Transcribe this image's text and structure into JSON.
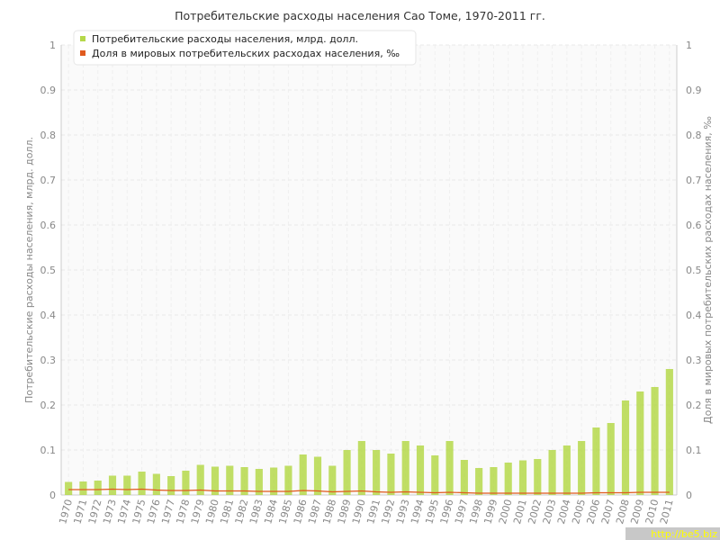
{
  "watermark": "http://be5.biz",
  "chart_data": {
    "type": "bar",
    "title": "Потребительские расходы населения Сао Томе, 1970-2011 гг.",
    "ylabel": "Потребительские расходы населения, млрд. долл.",
    "y2label": "Доля в мировых потребительских расходах населения, ‰",
    "ylim": [
      0,
      1
    ],
    "y2lim": [
      0,
      1
    ],
    "yticks": [
      "0",
      "0.1",
      "0.2",
      "0.3",
      "0.4",
      "0.5",
      "0.6",
      "0.7",
      "0.8",
      "0.9",
      "1"
    ],
    "grid": true,
    "legend_position": "top-left",
    "categories": [
      "1970",
      "1971",
      "1972",
      "1973",
      "1974",
      "1975",
      "1976",
      "1977",
      "1978",
      "1979",
      "1980",
      "1981",
      "1982",
      "1983",
      "1984",
      "1985",
      "1986",
      "1987",
      "1988",
      "1989",
      "1990",
      "1991",
      "1992",
      "1993",
      "1994",
      "1995",
      "1996",
      "1997",
      "1998",
      "1999",
      "2000",
      "2001",
      "2002",
      "2003",
      "2004",
      "2005",
      "2006",
      "2007",
      "2008",
      "2009",
      "2010",
      "2011"
    ],
    "series": [
      {
        "name": "Потребительские расходы населения, млрд. долл.",
        "type": "bar",
        "axis": "left",
        "color": "#b5d84a",
        "values": [
          0.029,
          0.03,
          0.032,
          0.043,
          0.043,
          0.052,
          0.047,
          0.042,
          0.054,
          0.067,
          0.063,
          0.065,
          0.062,
          0.058,
          0.061,
          0.065,
          0.09,
          0.085,
          0.065,
          0.1,
          0.12,
          0.1,
          0.092,
          0.12,
          0.11,
          0.088,
          0.12,
          0.078,
          0.06,
          0.062,
          0.072,
          0.077,
          0.08,
          0.1,
          0.11,
          0.12,
          0.15,
          0.16,
          0.21,
          0.23,
          0.24,
          0.28
        ]
      },
      {
        "name": "Доля в мировых потребительских расходах населения, ‰",
        "type": "line",
        "axis": "right",
        "color": "#e05a1e",
        "values": [
          0.012,
          0.012,
          0.012,
          0.013,
          0.012,
          0.013,
          0.011,
          0.01,
          0.01,
          0.011,
          0.009,
          0.009,
          0.009,
          0.008,
          0.008,
          0.008,
          0.01,
          0.009,
          0.007,
          0.008,
          0.009,
          0.007,
          0.006,
          0.007,
          0.006,
          0.005,
          0.006,
          0.005,
          0.004,
          0.004,
          0.004,
          0.004,
          0.004,
          0.004,
          0.004,
          0.004,
          0.005,
          0.005,
          0.005,
          0.006,
          0.006,
          0.006
        ]
      }
    ]
  }
}
